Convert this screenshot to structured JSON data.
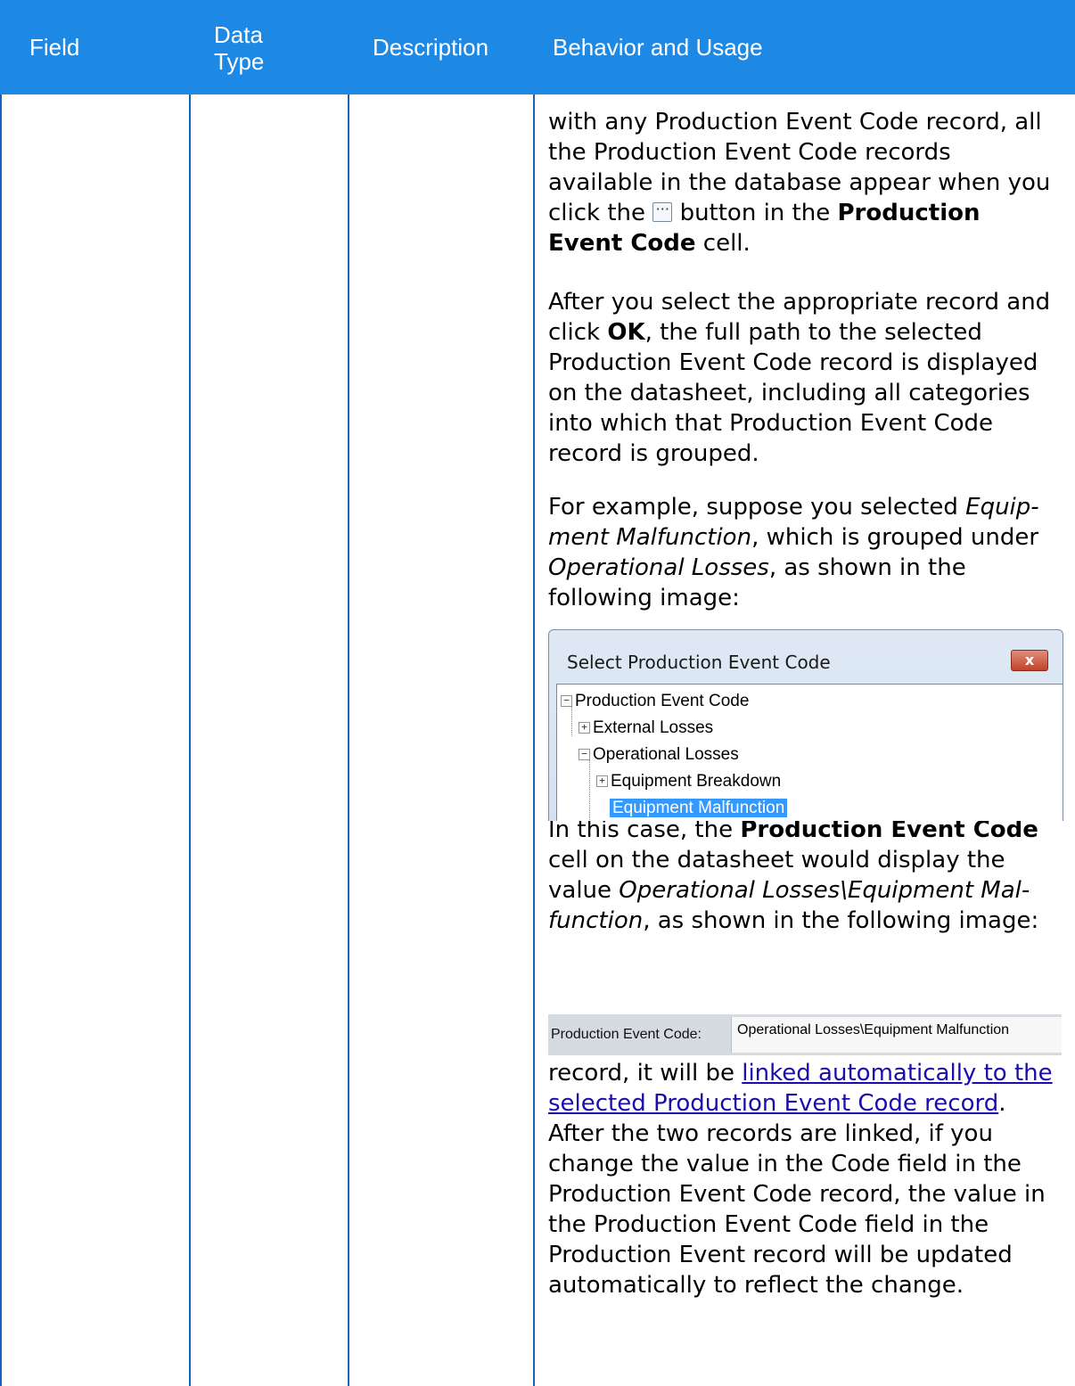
{
  "header": {
    "field": "Field",
    "data_type": "Data Type",
    "description": "Description",
    "behavior": "Behavior and Usage"
  },
  "content": {
    "p1_a": "with any Production Event Code record, all the Production Event Code records available in the database appear when you click the",
    "p1_b": "button in the",
    "p1_bold": "Production Event Code",
    "p1_c": "cell.",
    "p2_a": "After you select the appropriate record and click",
    "p2_bold": "OK",
    "p2_b": ", the full path to the selected Production Event Code record is dis­played on the datasheet, including all cat­egories into which that Production Event Code record is grouped.",
    "p3_a": "For example, suppose you selected",
    "p3_i1": "Equip­ment Malfunction",
    "p3_b": ", which is grouped under",
    "p3_i2": "Operational Losses",
    "p3_c": ", as shown in the following image:",
    "p4_a": "In this case, the",
    "p4_bold": "Production Event Code",
    "p4_b": "cell on the datasheet would display the value",
    "p4_i": "Operational Losses\\Equipment Mal­function",
    "p4_c": ", as shown in the following image:",
    "p5_a": "When you save the Production Event record, it will be",
    "p5_link": "linked automatically to the selected Production Event Code record",
    "p5_b": ". After the two records are linked, if you change the value in the Code field in the Production Event Code record, the value in the Production Event Code field in the Production Event record will be updated automatically  to reflect the change."
  },
  "dialog": {
    "title": "Select Production Event Code",
    "close": "x",
    "tree": {
      "root": "Production Event Code",
      "external": "External Losses",
      "operational": "Operational Losses",
      "breakdown": "Equipment Breakdown",
      "malfunction": "Equipment Malfunction"
    }
  },
  "field": {
    "label": "Production Event Code:",
    "value": "Operational Losses\\Equipment Malfunction"
  }
}
